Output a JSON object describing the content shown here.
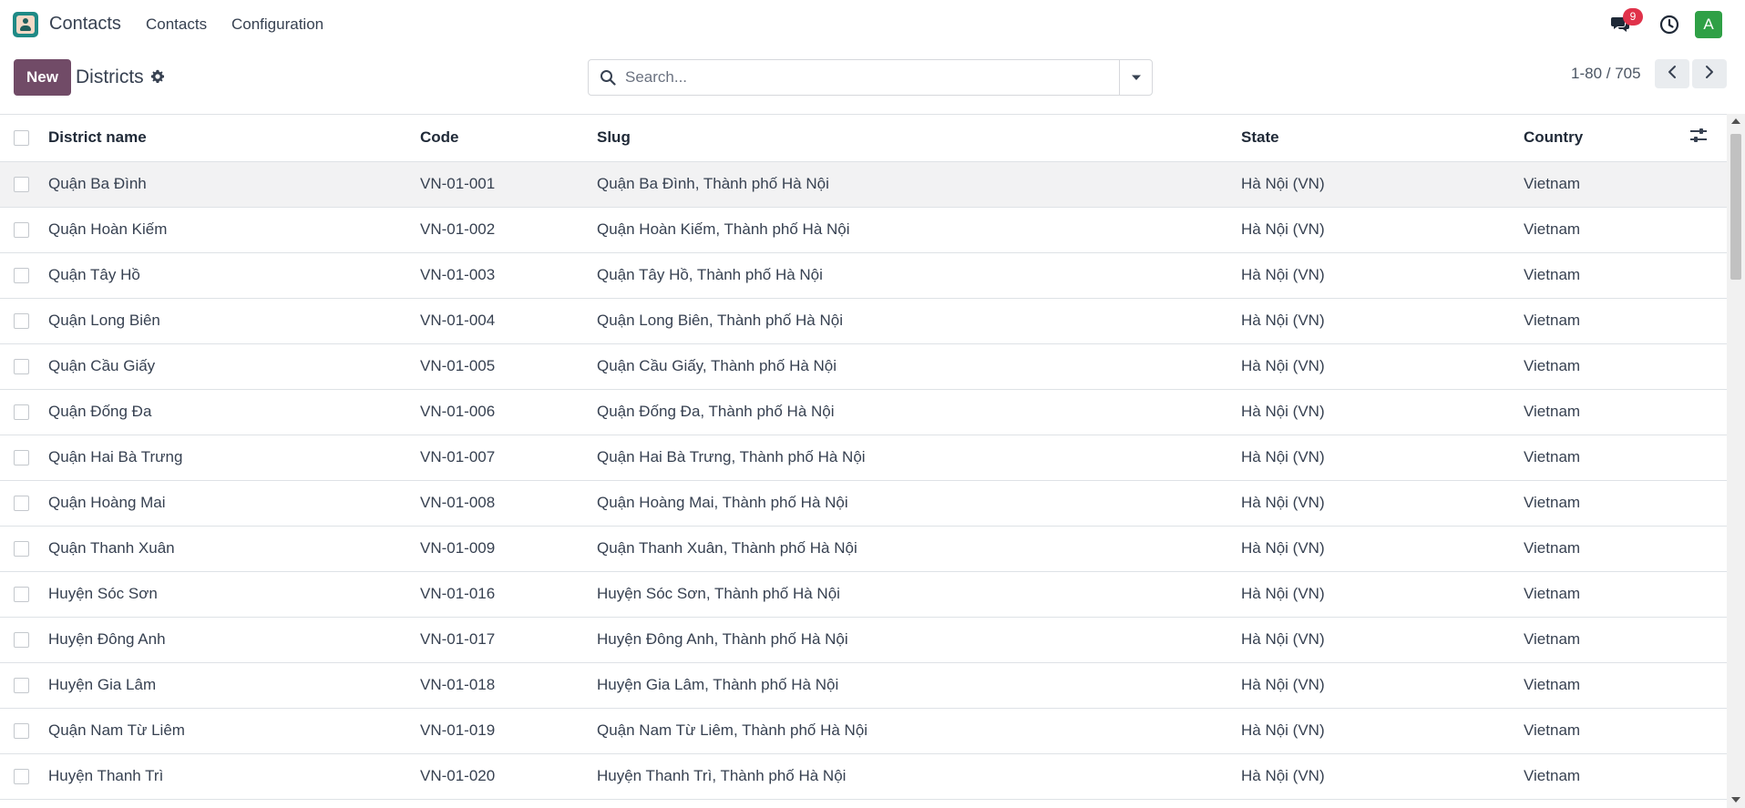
{
  "navbar": {
    "app_name": "Contacts",
    "menus": [
      "Contacts",
      "Configuration"
    ],
    "messages_count": "9",
    "avatar_letter": "A"
  },
  "control_panel": {
    "new_label": "New",
    "title": "Districts",
    "search_placeholder": "Search...",
    "pager_value": "1-80 / 705"
  },
  "colors": {
    "primary": "#714b67",
    "badge": "#e0324a",
    "avatar": "#2fa046",
    "app_logo": "#1f8a86"
  },
  "table": {
    "columns": [
      "District name",
      "Code",
      "Slug",
      "State",
      "Country"
    ],
    "rows": [
      [
        "Quận Ba Đình",
        "VN-01-001",
        "Quận Ba Đình, Thành phố Hà Nội",
        "Hà Nội (VN)",
        "Vietnam"
      ],
      [
        "Quận Hoàn Kiếm",
        "VN-01-002",
        "Quận Hoàn Kiếm, Thành phố Hà Nội",
        "Hà Nội (VN)",
        "Vietnam"
      ],
      [
        "Quận Tây Hồ",
        "VN-01-003",
        "Quận Tây Hồ, Thành phố Hà Nội",
        "Hà Nội (VN)",
        "Vietnam"
      ],
      [
        "Quận Long Biên",
        "VN-01-004",
        "Quận Long Biên, Thành phố Hà Nội",
        "Hà Nội (VN)",
        "Vietnam"
      ],
      [
        "Quận Cầu Giấy",
        "VN-01-005",
        "Quận Cầu Giấy, Thành phố Hà Nội",
        "Hà Nội (VN)",
        "Vietnam"
      ],
      [
        "Quận Đống Đa",
        "VN-01-006",
        "Quận Đống Đa, Thành phố Hà Nội",
        "Hà Nội (VN)",
        "Vietnam"
      ],
      [
        "Quận Hai Bà Trưng",
        "VN-01-007",
        "Quận Hai Bà Trưng, Thành phố Hà Nội",
        "Hà Nội (VN)",
        "Vietnam"
      ],
      [
        "Quận Hoàng Mai",
        "VN-01-008",
        "Quận Hoàng Mai, Thành phố Hà Nội",
        "Hà Nội (VN)",
        "Vietnam"
      ],
      [
        "Quận Thanh Xuân",
        "VN-01-009",
        "Quận Thanh Xuân, Thành phố Hà Nội",
        "Hà Nội (VN)",
        "Vietnam"
      ],
      [
        "Huyện Sóc Sơn",
        "VN-01-016",
        "Huyện Sóc Sơn, Thành phố Hà Nội",
        "Hà Nội (VN)",
        "Vietnam"
      ],
      [
        "Huyện Đông Anh",
        "VN-01-017",
        "Huyện Đông Anh, Thành phố Hà Nội",
        "Hà Nội (VN)",
        "Vietnam"
      ],
      [
        "Huyện Gia Lâm",
        "VN-01-018",
        "Huyện Gia Lâm, Thành phố Hà Nội",
        "Hà Nội (VN)",
        "Vietnam"
      ],
      [
        "Quận Nam Từ Liêm",
        "VN-01-019",
        "Quận Nam Từ Liêm, Thành phố Hà Nội",
        "Hà Nội (VN)",
        "Vietnam"
      ],
      [
        "Huyện Thanh Trì",
        "VN-01-020",
        "Huyện Thanh Trì, Thành phố Hà Nội",
        "Hà Nội (VN)",
        "Vietnam"
      ]
    ]
  }
}
